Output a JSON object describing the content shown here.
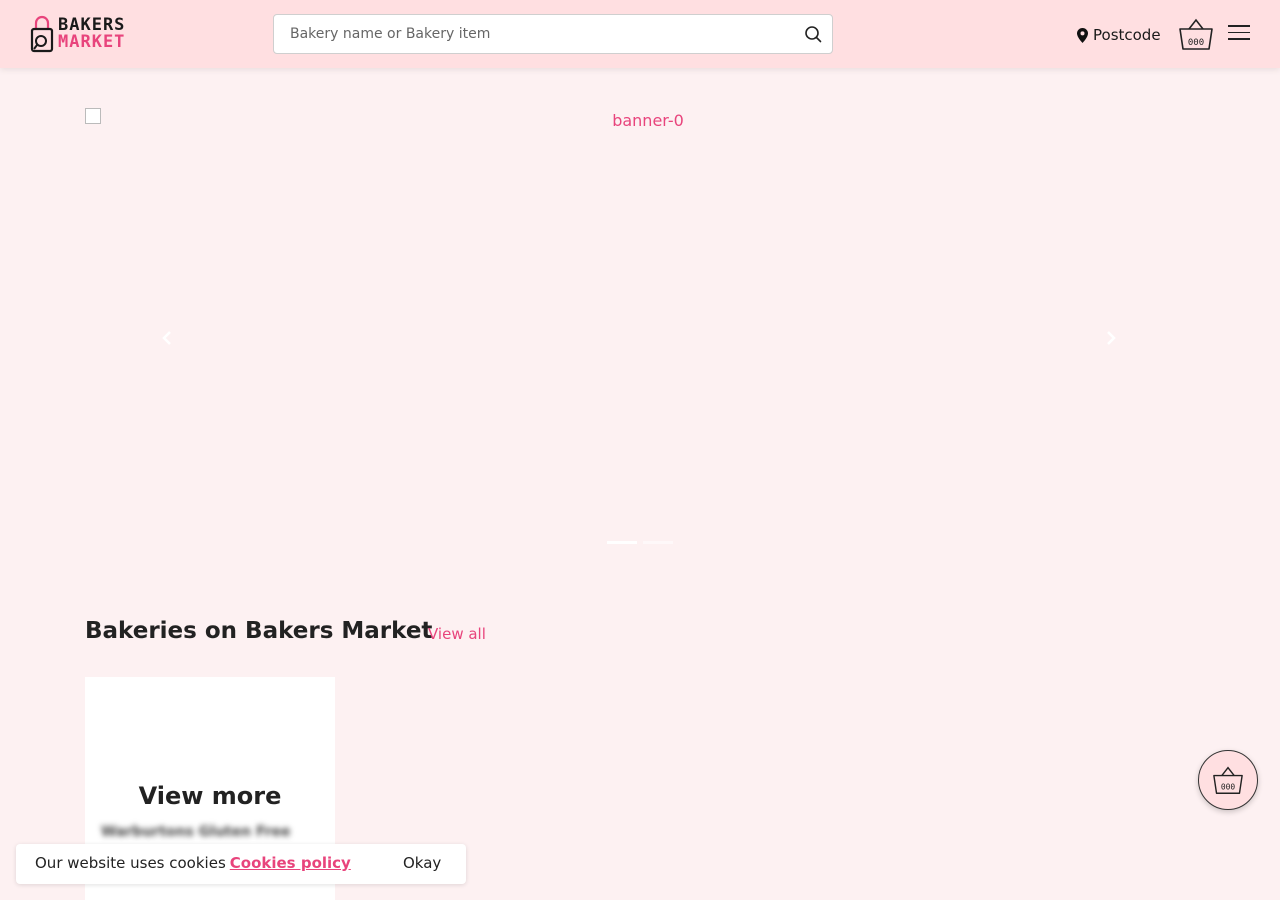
{
  "header": {
    "logo_line1": "BAKERS",
    "logo_line2": "MARKET",
    "search_placeholder": "Bakery name or Bakery item",
    "postcode_label": "Postcode",
    "icons": [
      "search-icon",
      "location-pin-icon",
      "basket-icon",
      "menu-icon"
    ]
  },
  "banner": {
    "image_alt": "banner-0",
    "slide_count": 2,
    "active_slide": 0
  },
  "section": {
    "title": "Bakeries on Bakers Market",
    "view_all": "View all"
  },
  "card": {
    "view_more": "View more",
    "product_name": "Warburtons Gluten Free"
  },
  "cookie": {
    "text": "Our website uses cookies",
    "link": "Cookies policy",
    "okay": "Okay"
  },
  "colors": {
    "accent": "#e8447c",
    "header_bg": "#ffdfe1",
    "page_bg": "#fdf1f2"
  }
}
